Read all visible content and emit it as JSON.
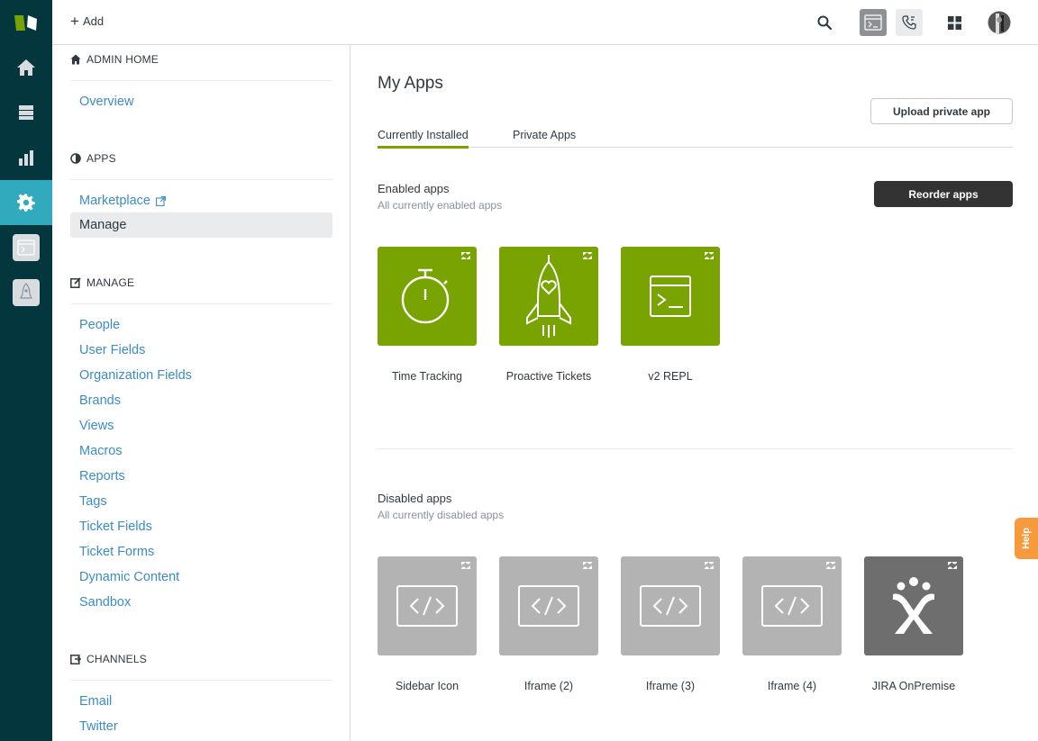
{
  "topbar": {
    "add_label": "Add"
  },
  "sidebar": {
    "sections": [
      {
        "id": "admin-home",
        "title": "ADMIN HOME",
        "icon": "house-icon",
        "items": [
          {
            "label": "Overview"
          }
        ]
      },
      {
        "id": "apps",
        "title": "APPS",
        "icon": "contrast-icon",
        "items": [
          {
            "label": "Marketplace",
            "external": true
          },
          {
            "label": "Manage",
            "current": true
          }
        ]
      },
      {
        "id": "manage",
        "title": "MANAGE",
        "icon": "edit-icon",
        "items": [
          {
            "label": "People"
          },
          {
            "label": "User Fields"
          },
          {
            "label": "Organization Fields"
          },
          {
            "label": "Brands"
          },
          {
            "label": "Views"
          },
          {
            "label": "Macros"
          },
          {
            "label": "Reports"
          },
          {
            "label": "Tags"
          },
          {
            "label": "Ticket Fields"
          },
          {
            "label": "Ticket Forms"
          },
          {
            "label": "Dynamic Content"
          },
          {
            "label": "Sandbox"
          }
        ]
      },
      {
        "id": "channels",
        "title": "CHANNELS",
        "icon": "channels-icon",
        "items": [
          {
            "label": "Email"
          },
          {
            "label": "Twitter"
          }
        ]
      }
    ]
  },
  "main": {
    "title": "My Apps",
    "upload_label": "Upload private app",
    "tabs": [
      {
        "label": "Currently Installed",
        "active": true
      },
      {
        "label": "Private Apps"
      }
    ],
    "enabled": {
      "title": "Enabled apps",
      "subtitle": "All currently enabled apps",
      "reorder_label": "Reorder apps",
      "apps": [
        {
          "name": "Time Tracking",
          "icon": "stopwatch-icon"
        },
        {
          "name": "Proactive Tickets",
          "icon": "rocket-icon"
        },
        {
          "name": "v2 REPL",
          "icon": "terminal-icon"
        }
      ]
    },
    "disabled": {
      "title": "Disabled apps",
      "subtitle": "All currently disabled apps",
      "apps": [
        {
          "name": "Sidebar Icon",
          "icon": "code-icon"
        },
        {
          "name": "Iframe (2)",
          "icon": "code-icon"
        },
        {
          "name": "Iframe (3)",
          "icon": "code-icon"
        },
        {
          "name": "Iframe (4)",
          "icon": "code-icon"
        },
        {
          "name": "JIRA OnPremise",
          "icon": "jira-icon"
        }
      ]
    }
  },
  "help_label": "Help",
  "colors": {
    "rail": "#03363d",
    "rail_selected": "#30aabc",
    "link": "#3a8cc9",
    "enabled_tile": "#78a300",
    "disabled_tile": "#b3b3b3",
    "help": "#f79a3e"
  }
}
